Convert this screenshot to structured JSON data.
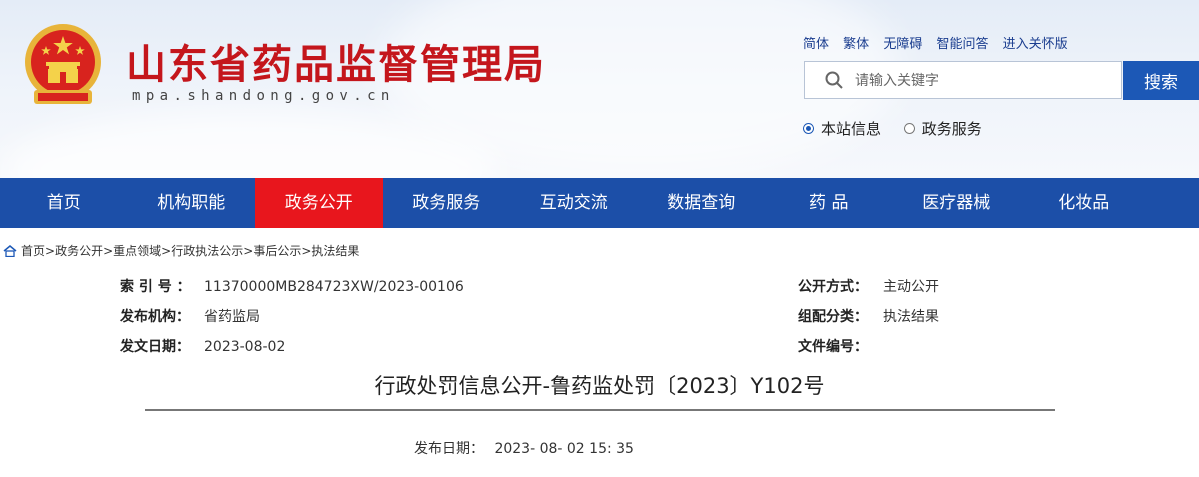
{
  "site": {
    "title": "山东省药品监督管理局",
    "url": "mpa.shandong.gov.cn"
  },
  "toplinks": [
    "简体",
    "繁体",
    "无障碍",
    "智能问答",
    "进入关怀版"
  ],
  "search": {
    "placeholder": "请输入关键字",
    "value": "",
    "button_label": "搜索",
    "scopes": [
      {
        "label": "本站信息",
        "selected": true
      },
      {
        "label": "政务服务",
        "selected": false
      }
    ]
  },
  "nav": {
    "items": [
      "首页",
      "机构职能",
      "政务公开",
      "政务服务",
      "互动交流",
      "数据查询",
      "药 品",
      "医疗器械",
      "化妆品"
    ],
    "active_index": 2
  },
  "breadcrumb": {
    "items": [
      "首页",
      "政务公开",
      "重点领域",
      "行政执法公示",
      "事后公示",
      "执法结果"
    ],
    "separator": ">"
  },
  "meta": {
    "index_no": {
      "label": "索 引 号 ：",
      "value": "11370000MB284723XW/2023-00106"
    },
    "publisher": {
      "label": "发布机构：",
      "value": "省药监局"
    },
    "issue_date": {
      "label": "发文日期：",
      "value": "2023-08-02"
    },
    "open_mode": {
      "label": "公开方式：",
      "value": "主动公开"
    },
    "category": {
      "label": "组配分类：",
      "value": "执法结果"
    },
    "doc_no": {
      "label": "文件编号：",
      "value": ""
    }
  },
  "article": {
    "title": "行政处罚信息公开-鲁药监处罚〔2023〕Y102号",
    "publish_label": "发布日期：",
    "publish_value": "2023- 08- 02 15: 35"
  },
  "colors": {
    "brand_red": "#c4161c",
    "nav_blue": "#1c4fa8",
    "nav_active": "#e8161d",
    "search_button": "#1c58b6"
  },
  "icons": {
    "emblem": "national-emblem",
    "search": "search-icon",
    "home": "home-icon"
  }
}
